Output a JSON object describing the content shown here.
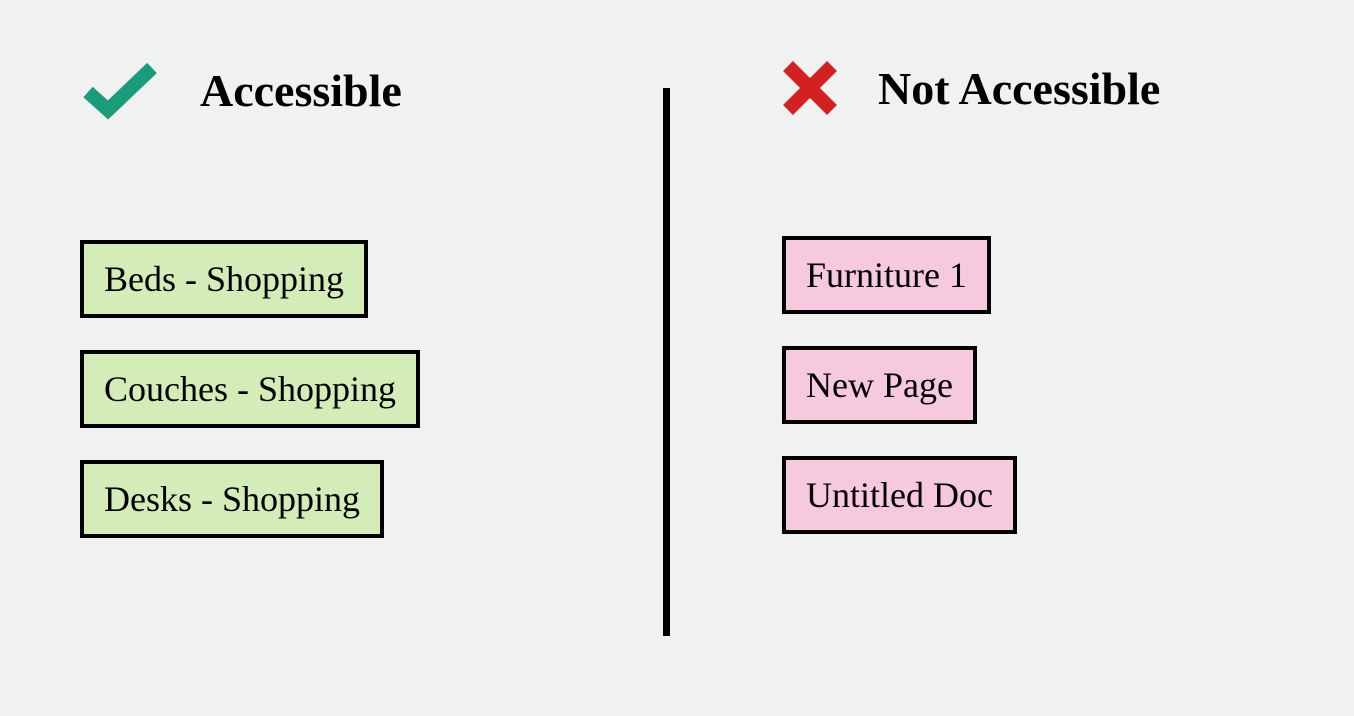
{
  "accessible": {
    "title": "Accessible",
    "items": [
      "Beds - Shopping",
      "Couches - Shopping",
      "Desks - Shopping"
    ]
  },
  "not_accessible": {
    "title": "Not Accessible",
    "items": [
      "Furniture 1",
      "New Page",
      "Untitled Doc"
    ]
  }
}
